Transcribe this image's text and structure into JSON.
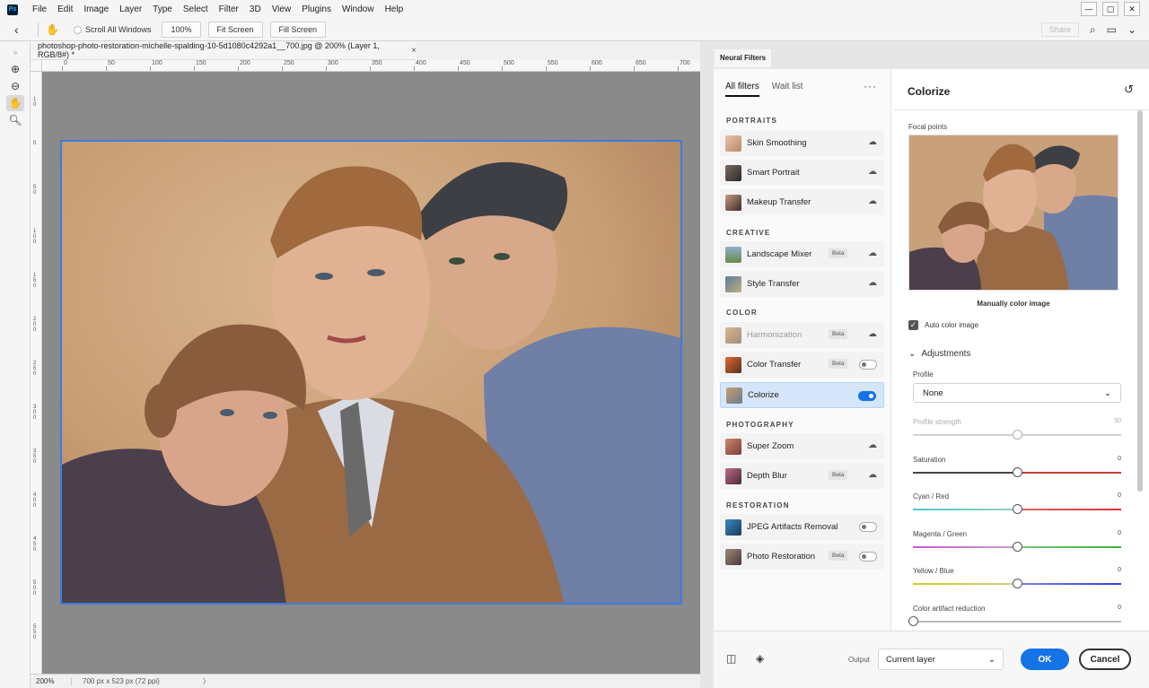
{
  "menubar": {
    "items": [
      "File",
      "Edit",
      "Image",
      "Layer",
      "Type",
      "Select",
      "Filter",
      "3D",
      "View",
      "Plugins",
      "Window",
      "Help"
    ],
    "window_controls": [
      "minimize-icon",
      "restore-icon",
      "close-icon"
    ]
  },
  "options_bar": {
    "scroll_all_windows": "Scroll All Windows",
    "zoom_100": "100%",
    "fit_screen": "Fit Screen",
    "fill_screen": "Fill Screen",
    "share": "Share"
  },
  "document": {
    "tab_title": "photoshop-photo-restoration-michelle-spalding-10-5d1080c4292a1__700.jpg @ 200% (Layer 1, RGB/8#) *",
    "ruler_top": [
      "0",
      "50",
      "100",
      "150",
      "200",
      "250",
      "300",
      "350",
      "400",
      "450",
      "500",
      "550",
      "600",
      "650",
      "700"
    ],
    "ruler_left": [
      "1 0",
      "0",
      "5 0",
      "1 0 0",
      "1 5 0",
      "2 0 0",
      "2 5 0",
      "3 0 0",
      "3 5 0",
      "4 0 0",
      "4 5 0",
      "5 0 0",
      "5 5 0"
    ],
    "status_zoom": "200%",
    "status_info": "700 px x 523 px (72 ppi)"
  },
  "neural_filters": {
    "panel_tab": "Neural Filters",
    "tabs": [
      "All filters",
      "Wait list"
    ],
    "more": "···",
    "categories": {
      "portraits": "PORTRAITS",
      "creative": "CREATIVE",
      "color": "COLOR",
      "photography": "PHOTOGRAPHY",
      "restoration": "RESTORATION"
    },
    "filters": {
      "skin_smoothing": "Skin Smoothing",
      "smart_portrait": "Smart Portrait",
      "makeup_transfer": "Makeup Transfer",
      "landscape_mixer": "Landscape Mixer",
      "style_transfer": "Style Transfer",
      "harmonization": "Harmonization",
      "color_transfer": "Color Transfer",
      "colorize": "Colorize",
      "super_zoom": "Super Zoom",
      "depth_blur": "Depth Blur",
      "jpeg_artifacts": "JPEG Artifacts Removal",
      "photo_restoration": "Photo Restoration"
    },
    "beta": "Beta",
    "settings": {
      "title": "Colorize",
      "focal_points": "Focal points",
      "manual_label": "Manually color image",
      "auto_color": "Auto color image",
      "adjustments": "Adjustments",
      "profile_label": "Profile",
      "profile_value": "None",
      "sliders": [
        {
          "label": "Profile strength",
          "value": "50",
          "level": 0.5,
          "disabled": true
        },
        {
          "label": "Saturation",
          "value": "0",
          "level": 0.5
        },
        {
          "label": "Cyan / Red",
          "value": "0",
          "level": 0.5
        },
        {
          "label": "Magenta / Green",
          "value": "0",
          "level": 0.5
        },
        {
          "label": "Yellow / Blue",
          "value": "0",
          "level": 0.5
        },
        {
          "label": "Color artifact reduction",
          "value": "0",
          "level": 0.0
        }
      ]
    },
    "footer": {
      "output_label": "Output",
      "output_value": "Current layer",
      "ok": "OK",
      "cancel": "Cancel"
    }
  },
  "colors": {
    "accent": "#1473e6",
    "selection": "#3d7be0"
  }
}
